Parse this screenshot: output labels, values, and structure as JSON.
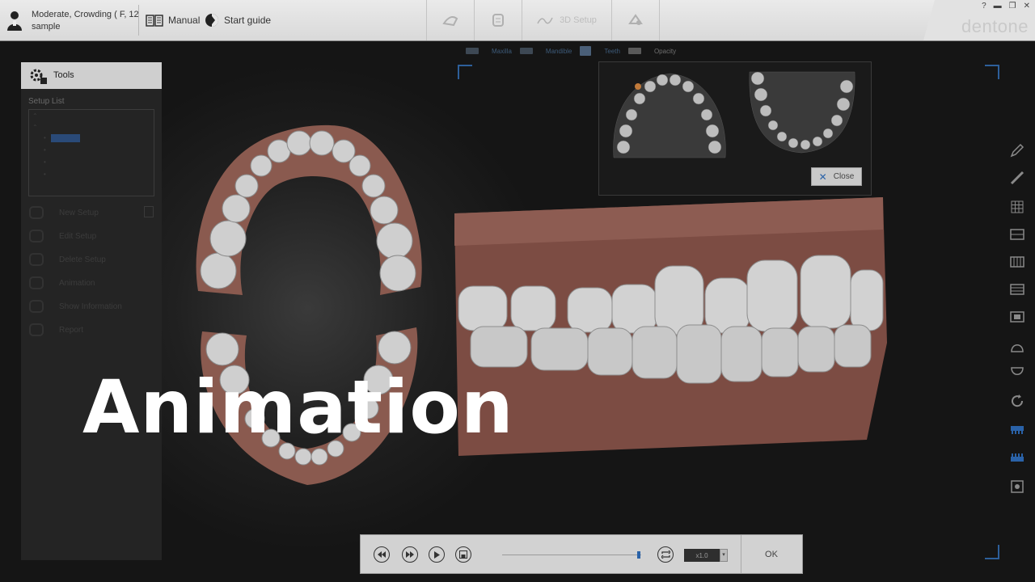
{
  "header": {
    "patient_name": "Moderate, Crowding ( F, 12",
    "patient_sub": "sample",
    "manual_label": "Manual",
    "start_guide_label": "Start guide",
    "step_3d_label": "3D Setup",
    "logo_text": "dentone"
  },
  "view_toolbar": {
    "maxilla": "Maxilla",
    "mandible": "Mandible",
    "teeth": "Teeth",
    "opacity": "Opacity"
  },
  "tools_panel": {
    "title": "Tools",
    "setup_list_label": "Setup List",
    "menu": [
      {
        "label": "New Setup",
        "icon": "new-setup-icon"
      },
      {
        "label": "Edit Setup",
        "icon": "edit-setup-icon"
      },
      {
        "label": "Delete Setup",
        "icon": "delete-setup-icon"
      },
      {
        "label": "Animation",
        "icon": "animation-icon"
      },
      {
        "label": "Show Information",
        "icon": "info-icon"
      },
      {
        "label": "Report",
        "icon": "report-icon"
      }
    ]
  },
  "minimap": {
    "close_label": "Close"
  },
  "playback": {
    "speed": "x1.0",
    "ok_label": "OK",
    "progress": 1.0
  },
  "overlay": {
    "title": "Animation"
  },
  "colors": {
    "accent": "#2a62a8",
    "gum": "#8a5a4f",
    "tooth": "#cfcfcf"
  }
}
